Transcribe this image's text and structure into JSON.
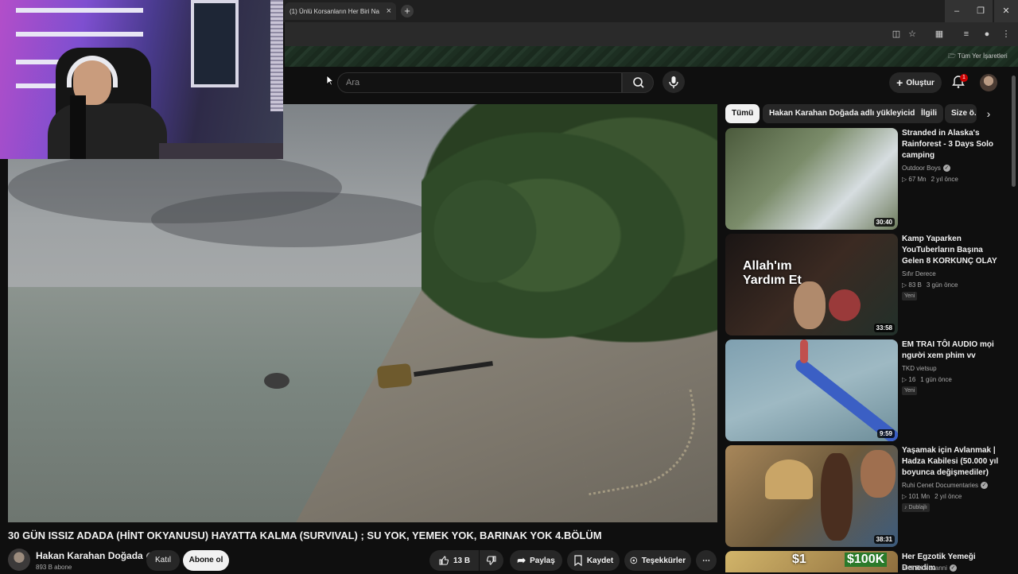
{
  "browser": {
    "tab_title": "(1) Ünlü Korsanların Her Biri Na",
    "tab_close": "×",
    "new_tab": "+",
    "bookmarks_all": "Tüm Yer İşaretleri"
  },
  "header": {
    "search_placeholder": "Ara",
    "create_label": "Oluştur",
    "notification_count": "1"
  },
  "video": {
    "title": "30 GÜN ISSIZ ADADA (HİNT OKYANUSU) HAYATTA KALMA (SURVIVAL) ; SU YOK, YEMEK YOK, BARINAK YOK 4.BÖLÜM",
    "channel": "Hakan Karahan Doğada",
    "subscribers": "893 B abone",
    "join_label": "Katıl",
    "subscribe_label": "Abone ol",
    "likes": "13 B",
    "share_label": "Paylaş",
    "save_label": "Kaydet",
    "thanks_label": "Teşekkürler"
  },
  "chips": {
    "all": "Tümü",
    "uploader": "Hakan Karahan Doğada adlı yükleyiciden",
    "related": "İlgili",
    "for_you": "Size ö..."
  },
  "recommendations": [
    {
      "title": "Stranded in Alaska's Rainforest - 3 Days Solo camping",
      "channel": "Outdoor Boys",
      "verified": true,
      "views": "▷ 67 Mn",
      "age": "2 yıl önce",
      "duration": "30:40",
      "badge": ""
    },
    {
      "title": "Kamp Yaparken YouTuberların Başına Gelen 8 KORKUNÇ OLAY",
      "channel": "Sıfır Derece",
      "verified": false,
      "views": "▷ 83 B",
      "age": "3 gün önce",
      "duration": "33:58",
      "badge": "Yeni",
      "thumb_text": "Allah'ım Yardım Et"
    },
    {
      "title": "EM TRAI TÔI AUDIO mọi người xem phim vv",
      "channel": "TKD vietsup",
      "verified": false,
      "views": "▷ 16",
      "age": "1 gün önce",
      "duration": "9:59",
      "badge": "Yeni"
    },
    {
      "title": "Yaşamak için Avlanmak | Hadza Kabilesi (50.000 yıl boyunca değişmediler)",
      "channel": "Ruhi Cenet Documentaries",
      "verified": true,
      "views": "▷ 101 Mn",
      "age": "2 yıl önce",
      "duration": "38:31",
      "badge": "Dublajlı"
    },
    {
      "title": "Her Egzotik Yemeği Denedim",
      "channel": "Nick DiGiovanni",
      "verified": true,
      "thumb_text_1": "$1",
      "thumb_text_2": "$100K"
    }
  ],
  "colors": {
    "background": "#0f0f0f",
    "accent_red": "#cc0000",
    "chip_active": "#f1f1f1"
  }
}
